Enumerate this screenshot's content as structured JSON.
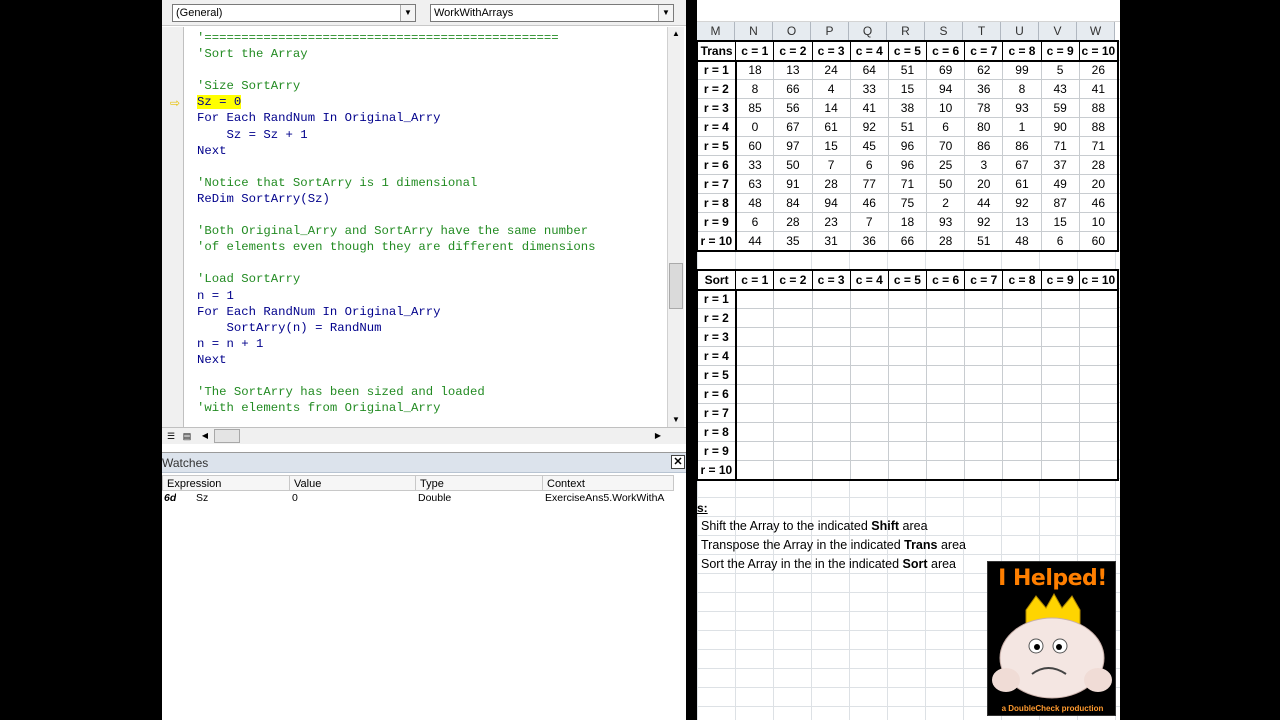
{
  "vba": {
    "combo_general": "(General)",
    "combo_proc": "WorkWithArrays",
    "code_lines": [
      {
        "text": "'================================================",
        "kind": "cm"
      },
      {
        "text": "'Sort the Array",
        "kind": "cm"
      },
      {
        "text": "",
        "kind": "tx"
      },
      {
        "text": "'Size SortArry",
        "kind": "cm"
      },
      {
        "text": "Sz = 0",
        "kind": "hl"
      },
      {
        "text": "For Each RandNum In Original_Arry",
        "kind": "kw"
      },
      {
        "text": "    Sz = Sz + 1",
        "kind": "kw"
      },
      {
        "text": "Next",
        "kind": "kw"
      },
      {
        "text": "",
        "kind": "tx"
      },
      {
        "text": "'Notice that SortArry is 1 dimensional",
        "kind": "cm"
      },
      {
        "text": "ReDim SortArry(Sz)",
        "kind": "kw"
      },
      {
        "text": "",
        "kind": "tx"
      },
      {
        "text": "'Both Original_Arry and SortArry have the same number",
        "kind": "cm"
      },
      {
        "text": "'of elements even though they are different dimensions",
        "kind": "cm"
      },
      {
        "text": "",
        "kind": "tx"
      },
      {
        "text": "'Load SortArry",
        "kind": "cm"
      },
      {
        "text": "n = 1",
        "kind": "kw"
      },
      {
        "text": "For Each RandNum In Original_Arry",
        "kind": "kw"
      },
      {
        "text": "    SortArry(n) = RandNum",
        "kind": "kw"
      },
      {
        "text": "n = n + 1",
        "kind": "kw"
      },
      {
        "text": "Next",
        "kind": "kw"
      },
      {
        "text": "",
        "kind": "tx"
      },
      {
        "text": "'The SortArry has been sized and loaded",
        "kind": "cm"
      },
      {
        "text": "'with elements from Original_Arry",
        "kind": "cm"
      }
    ],
    "watches": {
      "title": "Watches",
      "columns": [
        "Expression",
        "Value",
        "Type",
        "Context"
      ],
      "row": {
        "icon": "6d",
        "expression": "Sz",
        "value": "0",
        "type": "Double",
        "context": "ExerciseAns5.WorkWithA"
      }
    }
  },
  "excel": {
    "columns": [
      "M",
      "N",
      "O",
      "P",
      "Q",
      "R",
      "S",
      "T",
      "U",
      "V",
      "W"
    ],
    "trans": {
      "corner": "Trans",
      "col_headers": [
        "c = 1",
        "c = 2",
        "c = 3",
        "c = 4",
        "c = 5",
        "c = 6",
        "c = 7",
        "c = 8",
        "c = 9",
        "c = 10"
      ],
      "row_headers": [
        "r = 1",
        "r = 2",
        "r = 3",
        "r = 4",
        "r = 5",
        "r = 6",
        "r = 7",
        "r = 8",
        "r = 9",
        "r = 10"
      ],
      "rows": [
        [
          "18",
          "13",
          "24",
          "64",
          "51",
          "69",
          "62",
          "99",
          "5",
          "26"
        ],
        [
          "8",
          "66",
          "4",
          "33",
          "15",
          "94",
          "36",
          "8",
          "43",
          "41"
        ],
        [
          "85",
          "56",
          "14",
          "41",
          "38",
          "10",
          "78",
          "93",
          "59",
          "88"
        ],
        [
          "0",
          "67",
          "61",
          "92",
          "51",
          "6",
          "80",
          "1",
          "90",
          "88"
        ],
        [
          "60",
          "97",
          "15",
          "45",
          "96",
          "70",
          "86",
          "86",
          "71",
          "71"
        ],
        [
          "33",
          "50",
          "7",
          "6",
          "96",
          "25",
          "3",
          "67",
          "37",
          "28"
        ],
        [
          "63",
          "91",
          "28",
          "77",
          "71",
          "50",
          "20",
          "61",
          "49",
          "20"
        ],
        [
          "48",
          "84",
          "94",
          "46",
          "75",
          "2",
          "44",
          "92",
          "87",
          "46"
        ],
        [
          "6",
          "28",
          "23",
          "7",
          "18",
          "93",
          "92",
          "13",
          "15",
          "10"
        ],
        [
          "44",
          "35",
          "31",
          "36",
          "66",
          "28",
          "51",
          "48",
          "6",
          "60"
        ]
      ]
    },
    "sort": {
      "corner": "Sort",
      "col_headers": [
        "c = 1",
        "c = 2",
        "c = 3",
        "c = 4",
        "c = 5",
        "c = 6",
        "c = 7",
        "c = 8",
        "c = 9",
        "c = 10"
      ],
      "row_headers": [
        "r = 1",
        "r = 2",
        "r = 3",
        "r = 4",
        "r = 5",
        "r = 6",
        "r = 7",
        "r = 8",
        "r = 9",
        "r = 10"
      ]
    },
    "instructions_head": "s:",
    "instructions": [
      {
        "pre": "Shift the Array to the indicated ",
        "bold": "Shift",
        "post": " area"
      },
      {
        "pre": "Transpose the Array in the indicated ",
        "bold": "Trans",
        "post": " area"
      },
      {
        "pre": "Sort the Array in the in the indicated ",
        "bold": "Sort",
        "post": " area"
      }
    ],
    "badge": {
      "title": "I Helped!",
      "footer": "a DoubleCheck production",
      "accent": "#ff7f00"
    }
  }
}
